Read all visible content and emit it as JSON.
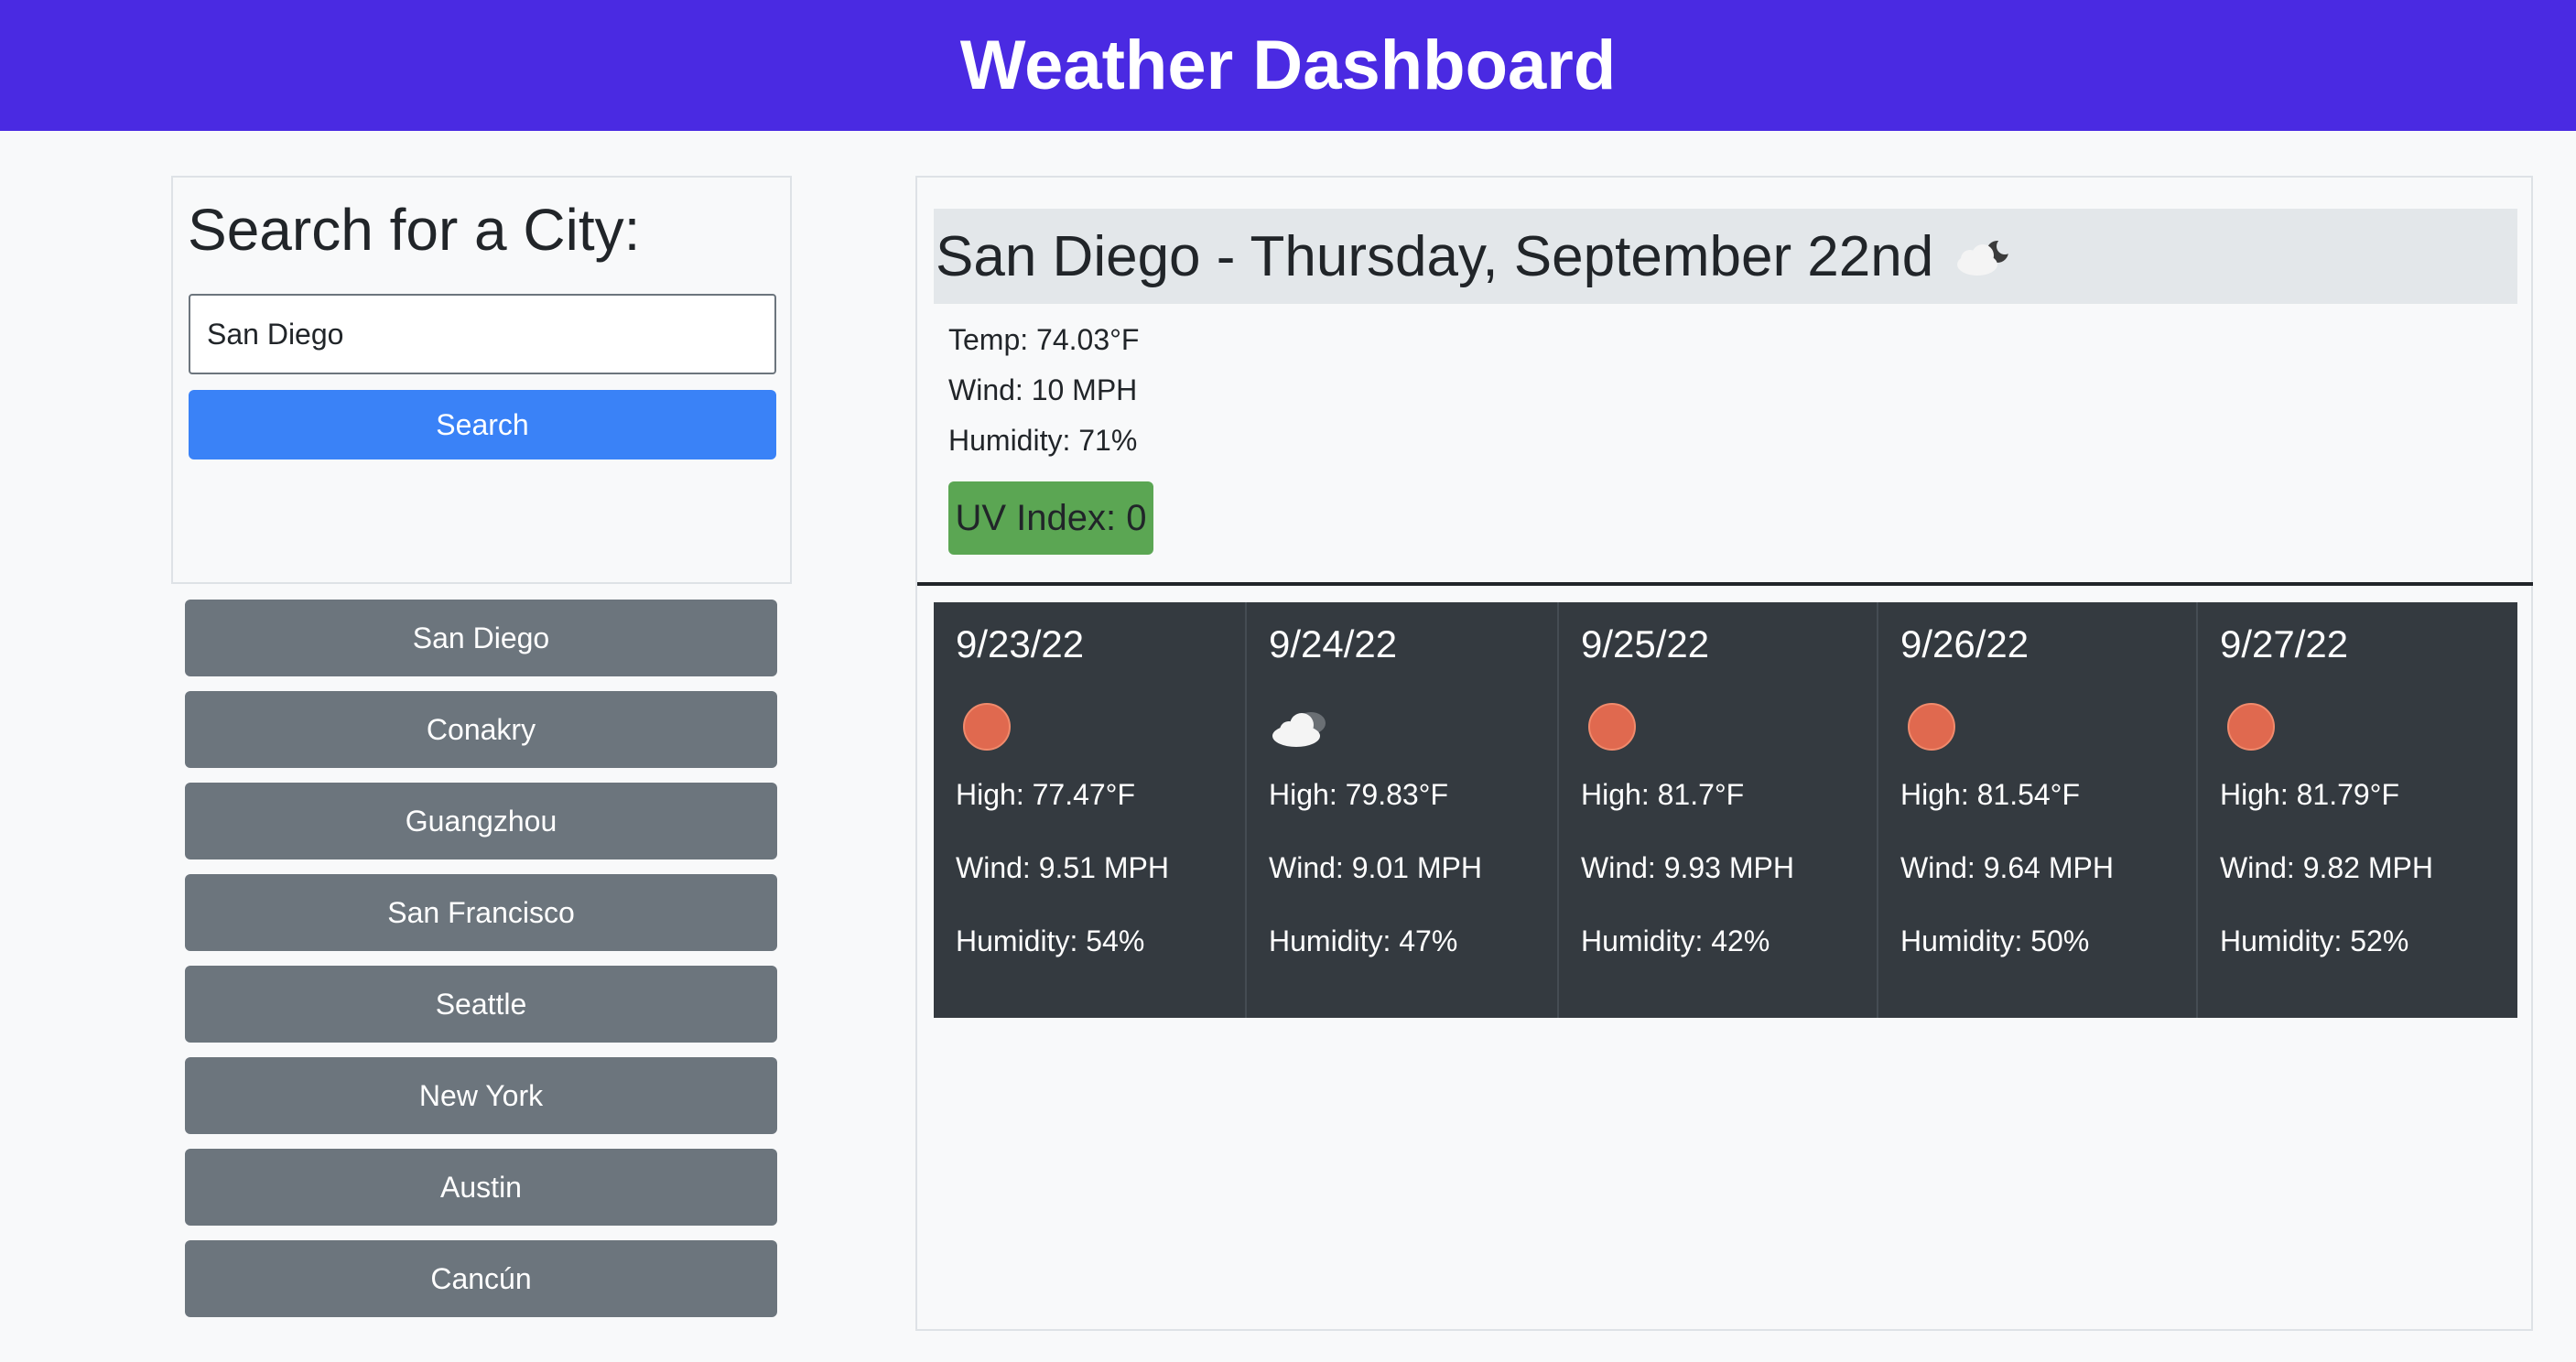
{
  "header": {
    "title": "Weather Dashboard"
  },
  "search": {
    "title": "Search for a City:",
    "input_value": "San Diego",
    "placeholder": "",
    "button_label": "Search"
  },
  "history": [
    "San Diego",
    "Conakry",
    "Guangzhou",
    "San Francisco",
    "Seattle",
    "New York",
    "Austin",
    "Cancún"
  ],
  "current": {
    "title": "San Diego - Thursday, September 22nd",
    "icon": "partly-cloudy-night-icon",
    "temp": "Temp: 74.03°F",
    "wind": "Wind: 10 MPH",
    "humidity": "Humidity: 71%",
    "uv": "UV Index: 0",
    "uv_color": "#5ba653"
  },
  "forecast": [
    {
      "date": "9/23/22",
      "icon": "sun-icon",
      "high": "High: 77.47°F",
      "wind": "Wind: 9.51 MPH",
      "humidity": "Humidity: 54%"
    },
    {
      "date": "9/24/22",
      "icon": "cloud-icon",
      "high": "High: 79.83°F",
      "wind": "Wind: 9.01 MPH",
      "humidity": "Humidity: 47%"
    },
    {
      "date": "9/25/22",
      "icon": "sun-icon",
      "high": "High: 81.7°F",
      "wind": "Wind: 9.93 MPH",
      "humidity": "Humidity: 42%"
    },
    {
      "date": "9/26/22",
      "icon": "sun-icon",
      "high": "High: 81.54°F",
      "wind": "Wind: 9.64 MPH",
      "humidity": "Humidity: 50%"
    },
    {
      "date": "9/27/22",
      "icon": "sun-icon",
      "high": "High: 81.79°F",
      "wind": "Wind: 9.82 MPH",
      "humidity": "Humidity: 52%"
    }
  ],
  "colors": {
    "header_bg": "#4a2ae2",
    "search_button": "#3a82f7",
    "history_button": "#6c757d",
    "forecast_bg": "#343a40",
    "sun": "#e0694f"
  }
}
